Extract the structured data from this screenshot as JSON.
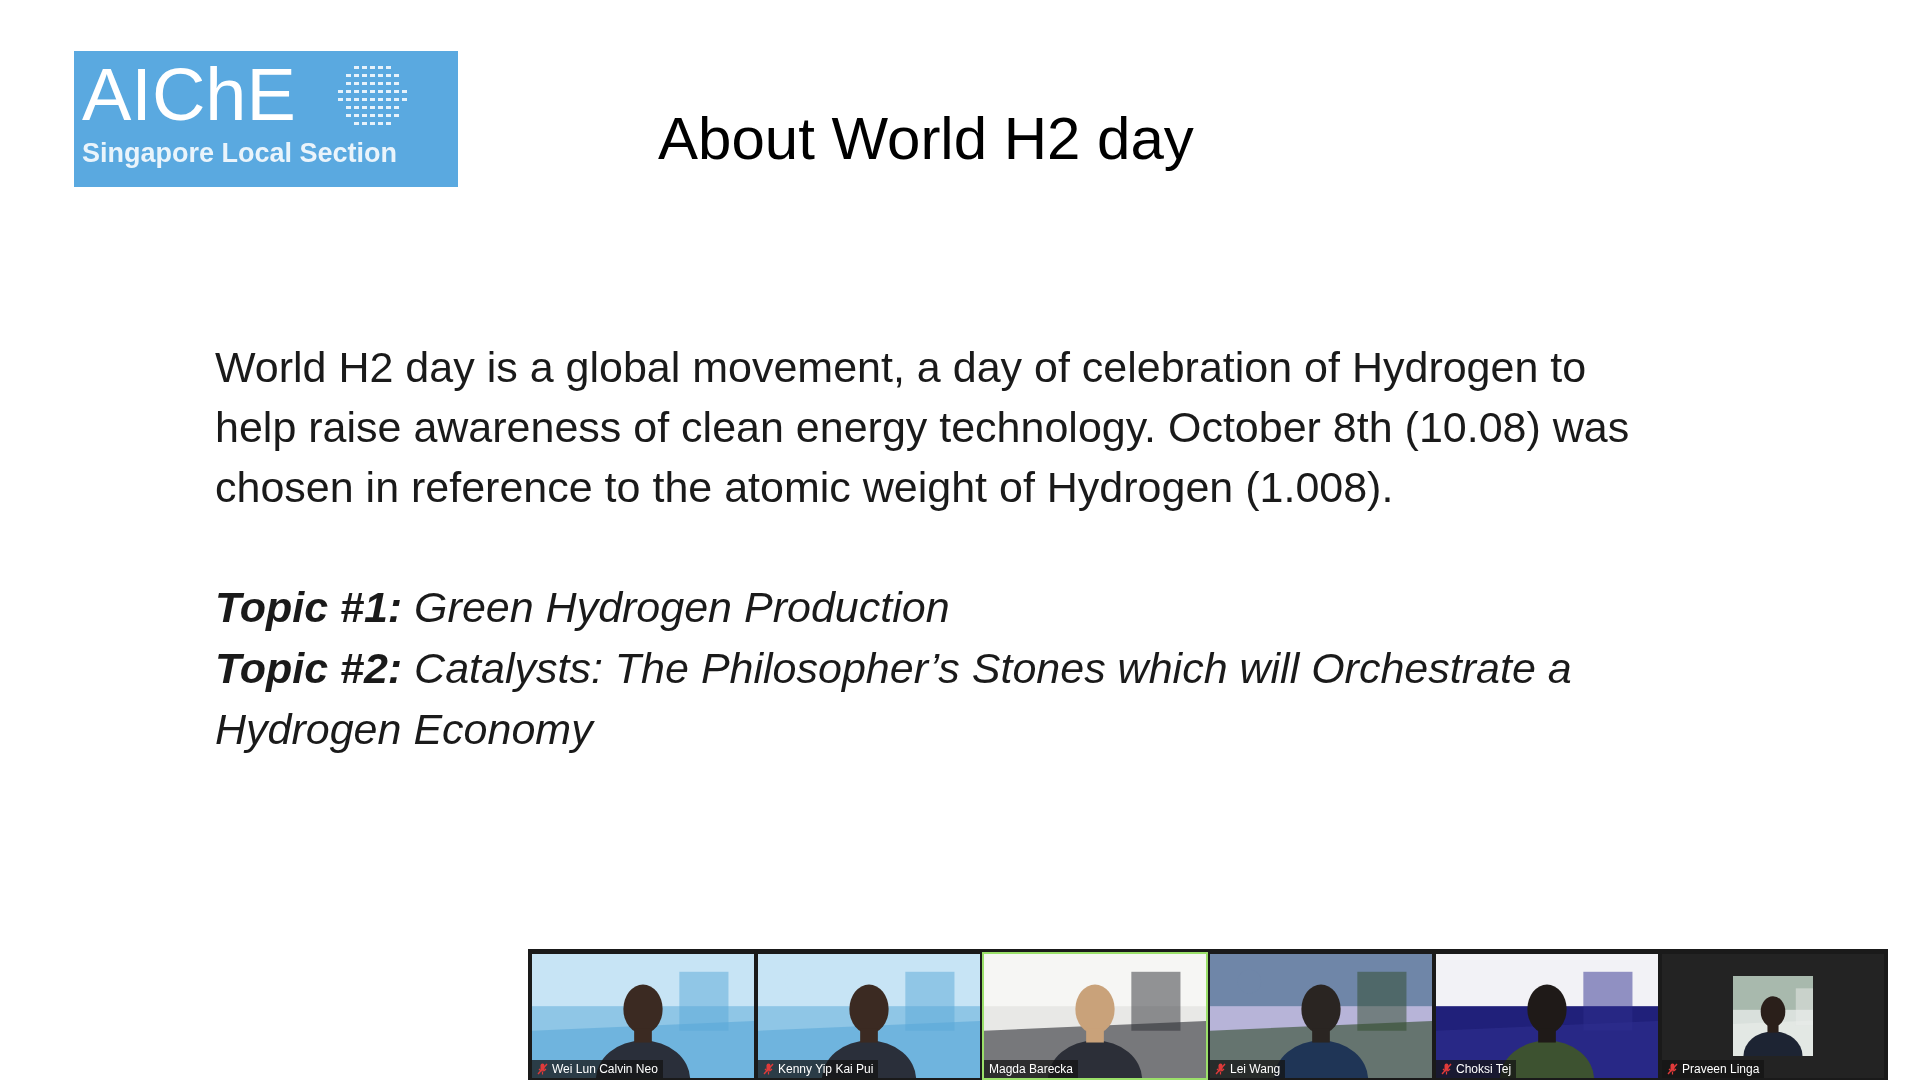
{
  "logo": {
    "title": "AIChE",
    "subtitle": "Singapore Local Section"
  },
  "slide": {
    "title": "About World H2 day",
    "paragraph": "World H2 day is a global movement, a day of celebration of Hydrogen to help raise awareness of clean energy technology. October 8th (10.08) was chosen in reference to the atomic weight of Hydrogen (1.008).",
    "topics": [
      "**Topic #1:** Green Hydrogen Production",
      "**Topic #2:** Catalysts: The Philosopher’s Stones which will Orchestrate a Hydrogen Economy"
    ]
  },
  "participants": [
    {
      "name": "Wei Lun Calvin Neo",
      "muted": true,
      "speaking": false,
      "kind": "video"
    },
    {
      "name": "Kenny Yip Kai Pui",
      "muted": true,
      "speaking": false,
      "kind": "video"
    },
    {
      "name": "Magda Barecka",
      "muted": false,
      "speaking": true,
      "kind": "video"
    },
    {
      "name": "Lei Wang",
      "muted": true,
      "speaking": false,
      "kind": "video"
    },
    {
      "name": "Choksi Tej",
      "muted": true,
      "speaking": false,
      "kind": "video"
    },
    {
      "name": "Praveen Linga",
      "muted": true,
      "speaking": false
    }
  ]
}
